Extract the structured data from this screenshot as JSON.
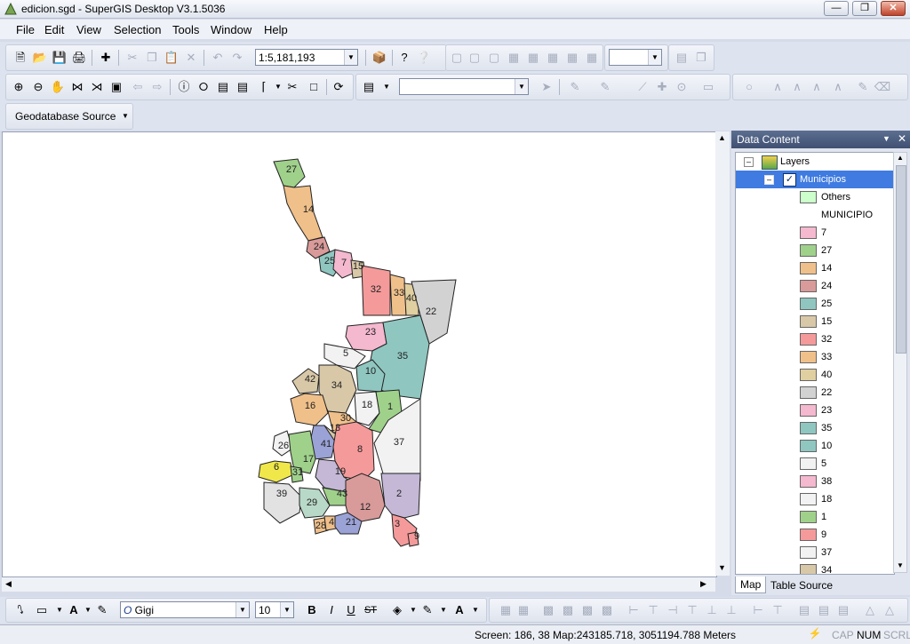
{
  "window": {
    "title": "edicion.sgd - SuperGIS Desktop V3.1.5036"
  },
  "menu": [
    "File",
    "Edit",
    "View",
    "Selection",
    "Tools",
    "Window",
    "Help"
  ],
  "toolbar": {
    "scale_value": "1:5,181,193",
    "source_label": "Geodatabase Source"
  },
  "panel": {
    "title": "Data Content",
    "layers_label": "Layers",
    "layer_name": "Municipios",
    "others_label": "Others",
    "field_name": "MUNICIPIO",
    "legend": [
      {
        "label": "7",
        "color": "#f4b8cf"
      },
      {
        "label": "27",
        "color": "#9fd18b"
      },
      {
        "label": "14",
        "color": "#f0c08a"
      },
      {
        "label": "24",
        "color": "#d99a9a"
      },
      {
        "label": "25",
        "color": "#8fc6c0"
      },
      {
        "label": "15",
        "color": "#d8c8a8"
      },
      {
        "label": "32",
        "color": "#f59a9a"
      },
      {
        "label": "33",
        "color": "#f0c08a"
      },
      {
        "label": "40",
        "color": "#e0cfa0"
      },
      {
        "label": "22",
        "color": "#d2d2d2"
      },
      {
        "label": "23",
        "color": "#f4b8cf"
      },
      {
        "label": "35",
        "color": "#8fc6c0"
      },
      {
        "label": "10",
        "color": "#8fc6c0"
      },
      {
        "label": "5",
        "color": "#f2f2f2"
      },
      {
        "label": "38",
        "color": "#f4b8cf"
      },
      {
        "label": "18",
        "color": "#f2f2f2"
      },
      {
        "label": "1",
        "color": "#9fd18b"
      },
      {
        "label": "9",
        "color": "#f59a9a"
      },
      {
        "label": "37",
        "color": "#f2f2f2"
      },
      {
        "label": "34",
        "color": "#d8c8a8"
      }
    ],
    "tabs": [
      "Map",
      "Table Source"
    ]
  },
  "drawbar": {
    "font_name": "Gigi",
    "font_size": "10"
  },
  "status": {
    "coords": "Screen: 186, 38  Map:243185.718, 3051194.788 Meters",
    "caps": "CAP",
    "num": "NUM",
    "scrl": "SCRL"
  },
  "map": {
    "regions": [
      {
        "label": "27",
        "color": "#9fd18b"
      },
      {
        "label": "14",
        "color": "#f0c08a"
      },
      {
        "label": "24",
        "color": "#d99a9a"
      },
      {
        "label": "25",
        "color": "#8fc6c0"
      },
      {
        "label": "7",
        "color": "#f4b8cf"
      },
      {
        "label": "15",
        "color": "#d8c8a8"
      },
      {
        "label": "32",
        "color": "#f59a9a"
      },
      {
        "label": "33",
        "color": "#f0c08a"
      },
      {
        "label": "40",
        "color": "#e0cfa0"
      },
      {
        "label": "22",
        "color": "#d2d2d2"
      },
      {
        "label": "23",
        "color": "#f4b8cf"
      },
      {
        "label": "35",
        "color": "#8fc6c0"
      },
      {
        "label": "5",
        "color": "#f2f2f2"
      },
      {
        "label": "10",
        "color": "#8fc6c0"
      },
      {
        "label": "42",
        "color": "#d8c8a8"
      },
      {
        "label": "34",
        "color": "#d8c8a8"
      },
      {
        "label": "16",
        "color": "#f0c08a"
      },
      {
        "label": "18",
        "color": "#f2f2f2"
      },
      {
        "label": "30",
        "color": "#f0c08a"
      },
      {
        "label": "13",
        "color": "#d8c8a8"
      },
      {
        "label": "1",
        "color": "#9fd18b"
      },
      {
        "label": "41",
        "color": "#9aa2d6"
      },
      {
        "label": "8",
        "color": "#f59a9a"
      },
      {
        "label": "37",
        "color": "#f2f2f2"
      },
      {
        "label": "26",
        "color": "#f2f2f2"
      },
      {
        "label": "17",
        "color": "#9fd18b"
      },
      {
        "label": "6",
        "color": "#f0e84a"
      },
      {
        "label": "31",
        "color": "#9fd18b"
      },
      {
        "label": "19",
        "color": "#c4b8d6"
      },
      {
        "label": "39",
        "color": "#e2e2e2"
      },
      {
        "label": "43",
        "color": "#9fd18b"
      },
      {
        "label": "29",
        "color": "#b9d9c8"
      },
      {
        "label": "12",
        "color": "#d99a9a"
      },
      {
        "label": "2",
        "color": "#c4b8d6"
      },
      {
        "label": "28",
        "color": "#f0c08a"
      },
      {
        "label": "4",
        "color": "#f0c08a"
      },
      {
        "label": "21",
        "color": "#9aa2d6"
      },
      {
        "label": "3",
        "color": "#f59a9a"
      },
      {
        "label": "9",
        "color": "#f59a9a"
      }
    ]
  }
}
